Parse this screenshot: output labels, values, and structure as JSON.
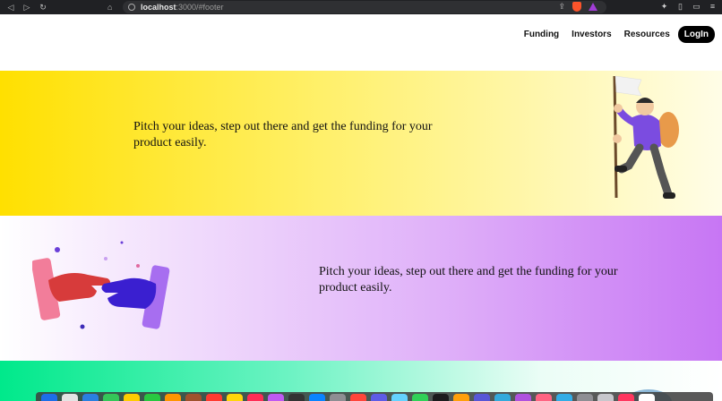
{
  "browser": {
    "url_host": "localhost",
    "url_path": ":3000/#footer"
  },
  "nav": {
    "funding": "Funding",
    "investors": "Investors",
    "resources": "Resources",
    "login": "LogIn"
  },
  "sections": [
    {
      "text": "Pitch your ideas, step out there and get the funding for your product easily."
    },
    {
      "text": "Pitch your ideas, step out there and get the funding for your product easily."
    }
  ],
  "colors": {
    "band1": "#ffe000",
    "band2": "#c776f4",
    "band3": "#00e98b"
  },
  "dock": {
    "apps": [
      "#1d6ee8",
      "#e4e4e4",
      "#2a7fe0",
      "#34c759",
      "#ffcc00",
      "#28c840",
      "#ff9500",
      "#a0522d",
      "#ff3b30",
      "#ffd60a",
      "#ff2d55",
      "#bf5af2",
      "#333333",
      "#0a84ff",
      "#8e8e93",
      "#ff453a",
      "#5e5ce6",
      "#64d2ff",
      "#30d158",
      "#1c1c1e",
      "#ff9f0a",
      "#5856d6",
      "#34aadc",
      "#af52de",
      "#ff6482",
      "#32ade6",
      "#8e8e93",
      "#c7c7cc",
      "#ff375f",
      "#ffffff"
    ]
  }
}
